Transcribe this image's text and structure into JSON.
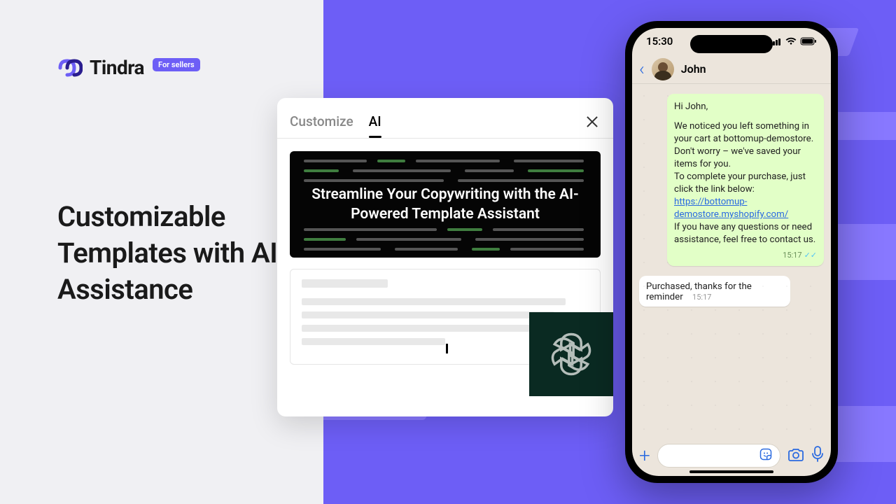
{
  "brand": {
    "name": "Tindra",
    "badge": "For sellers"
  },
  "headline": "Customizable Templates with AI Assistance",
  "ai_panel": {
    "tabs": {
      "customize": "Customize",
      "ai": "AI"
    },
    "banner_text": "Streamline Your Copywriting with the AI-Powered Template Assistant"
  },
  "phone": {
    "status_time": "15:30",
    "contact_name": "John",
    "outgoing_message": {
      "greeting": "Hi John,",
      "line1": "We noticed you left something in your cart at bottomup-demostore.",
      "line2": "Don't worry – we've saved your items for you.",
      "line3_pre": "To complete your purchase, just click the link below: ",
      "link": "https://bottomup-demostore.myshopify.com/",
      "line4": "If you have any questions or need assistance, feel free to contact us.",
      "time": "15:17"
    },
    "incoming_message": {
      "text": "Purchased, thanks for the reminder",
      "time": "15:17"
    }
  }
}
